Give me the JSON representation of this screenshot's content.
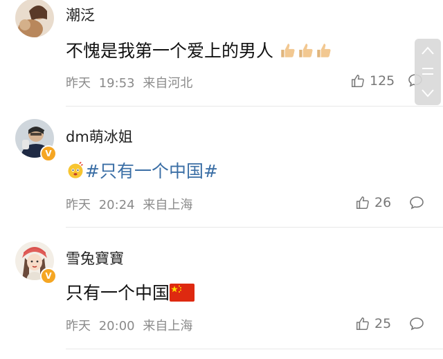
{
  "comments": [
    {
      "username": "潮泛",
      "text": "不愧是我第一个爱上的男人",
      "emojis": "thumbs-up x3",
      "date": "昨天",
      "time": "19:53",
      "location": "来自河北",
      "likes": "125",
      "verified": false
    },
    {
      "username": "dm萌冰姐",
      "hashtag": "#只有一个中国#",
      "date": "昨天",
      "time": "20:24",
      "location": "来自上海",
      "likes": "26",
      "verified": true
    },
    {
      "username": "雪兔寶寶",
      "text": "只有一个中国",
      "flag": "china-flag",
      "date": "昨天",
      "time": "20:00",
      "location": "来自上海",
      "likes": "25",
      "verified": true
    }
  ],
  "colors": {
    "hashtag": "#3a6ea5",
    "verified_badge": "#f5a623",
    "meta_text": "#8a8a8a"
  }
}
